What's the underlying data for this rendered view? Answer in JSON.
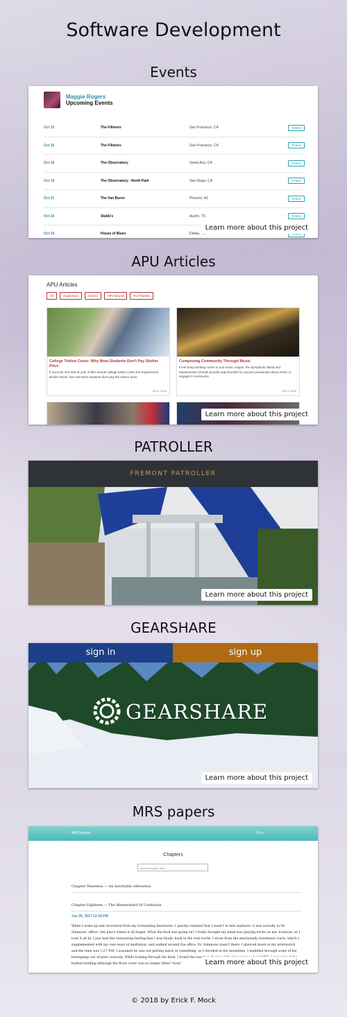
{
  "page": {
    "title": "Software Development",
    "footer": "© 2018 by Erick F. Mock"
  },
  "learn_more": "Learn more about this project",
  "events": {
    "section": "Events",
    "artist": "Maggie Rogers",
    "heading": "Upcoming Events",
    "rows": [
      {
        "date": "Oct 15",
        "venue": "The Fillmore",
        "city": "San Francisco, CA",
        "button": "Tickets"
      },
      {
        "date": "Oct 16",
        "venue": "The Fillmore",
        "city": "San Francisco, CA",
        "button": "Tickets"
      },
      {
        "date": "Oct 18",
        "venue": "The Observatory",
        "city": "Santa Ana, CA",
        "button": "Tickets"
      },
      {
        "date": "Oct 19",
        "venue": "The Observatory - North Park",
        "city": "San Diego, CA",
        "button": "Tickets"
      },
      {
        "date": "Oct 21",
        "venue": "The Van Buren",
        "city": "Phoenix, AZ",
        "button": "Tickets"
      },
      {
        "date": "Oct 23",
        "venue": "Stubb's",
        "city": "Austin, TX",
        "button": "Tickets"
      },
      {
        "date": "Oct 24",
        "venue": "House of Blues",
        "city": "Dallas, TX",
        "button": "Tickets"
      }
    ]
  },
  "apu": {
    "section": "APU Articles",
    "title": "APU Articles",
    "filters": [
      "All",
      "Academics",
      "Alumni",
      "APU Bound",
      "For Parents"
    ],
    "articles": [
      {
        "headline": "College Tuition Costs: Why Most Students Don't Pay Sticker Price",
        "excerpt": "If you look one look at your child's annual college tuition costs and experienced sticker shock, fear not! Most students don't pay the sticker price.",
        "date": "Oct 8, 2018"
      },
      {
        "headline": "Composing Community Through Music",
        "excerpt": "From busy working moms to non-music majors, the Symphonic Band and Masterworks Chorale provide opportunities for anyone passionate about music to engage in community.",
        "date": "Oct 4, 2018"
      }
    ]
  },
  "patroller": {
    "section": "PATROLLER",
    "banner": "FREMONT PATROLLER"
  },
  "gearshare": {
    "section": "GEARSHARE",
    "sign_in": "sign in",
    "sign_up": "sign up",
    "logo": "GEARSHARE"
  },
  "mrs": {
    "section": "MRS papers",
    "nav": "MRS papers",
    "go": "Go ▾",
    "chapters": "Chapters",
    "search_placeholder": "search chapter titles",
    "items": [
      "Chapter Nineteen — An Inevitable Alteration",
      "Chapter Eighteen — The Mastermind Of Confusion"
    ],
    "date": "Jun 26, 2017 12:16 PM",
    "body": "When I woke up and recovered from my tormenting heartache, I quickly realized that I wasn't in hell anymore—I was actually in Dr. Simmons' office—the place where it all began. What the fuck was going on? I really thought my mind was playing tricks on me; however, as I took it all in, I just had this reassuring feeling that I was finally back in the real world. I arose from the emotionally burdened couch, which I supplemented with my own tears of exaltation, and walked around the office. Dr. Simmons wasn't there. I glanced down at my wristwatch and the time was 1:27 P.M. I assumed he was out getting lunch or something, so I decided in the meantime, I meddled through some of his belongings out of pure curiosity. While looking through his desk, I found the one that disclosed the knowledge about MRS. I recognized the leather binding although the front cover was no longer titled \"Acey\""
  }
}
